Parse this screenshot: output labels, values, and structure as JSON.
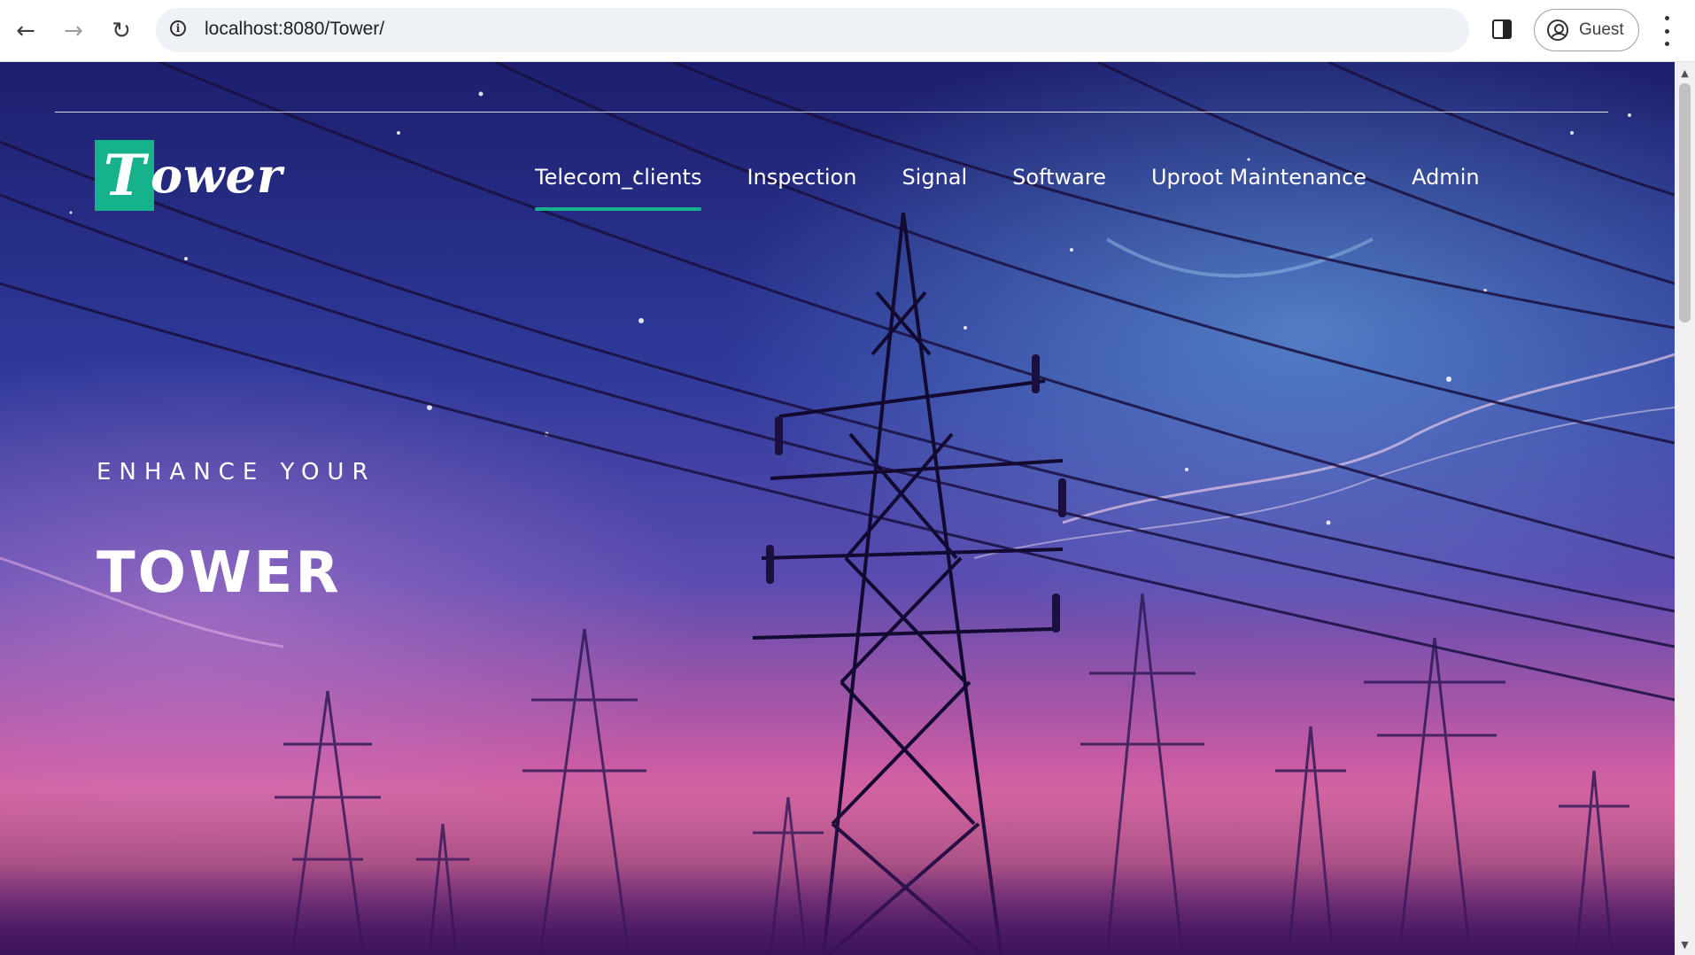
{
  "browser": {
    "back_icon": "←",
    "forward_icon": "→",
    "reload_icon": "↻",
    "info_icon": "i",
    "url": "localhost:8080/Tower/",
    "profile_label": "Guest"
  },
  "site": {
    "logo_initial": "T",
    "logo_rest": "ower",
    "nav": [
      {
        "label": "Telecom_clients",
        "active": true
      },
      {
        "label": "Inspection",
        "active": false
      },
      {
        "label": "Signal",
        "active": false
      },
      {
        "label": "Software",
        "active": false
      },
      {
        "label": "Uproot Maintenance",
        "active": false
      },
      {
        "label": "Admin",
        "active": false
      }
    ],
    "accent_color": "#16b28c"
  },
  "hero": {
    "kicker": "ENHANCE YOUR",
    "headline": "TOWER"
  },
  "scrollbar": {
    "up_icon": "▲",
    "down_icon": "▼"
  }
}
